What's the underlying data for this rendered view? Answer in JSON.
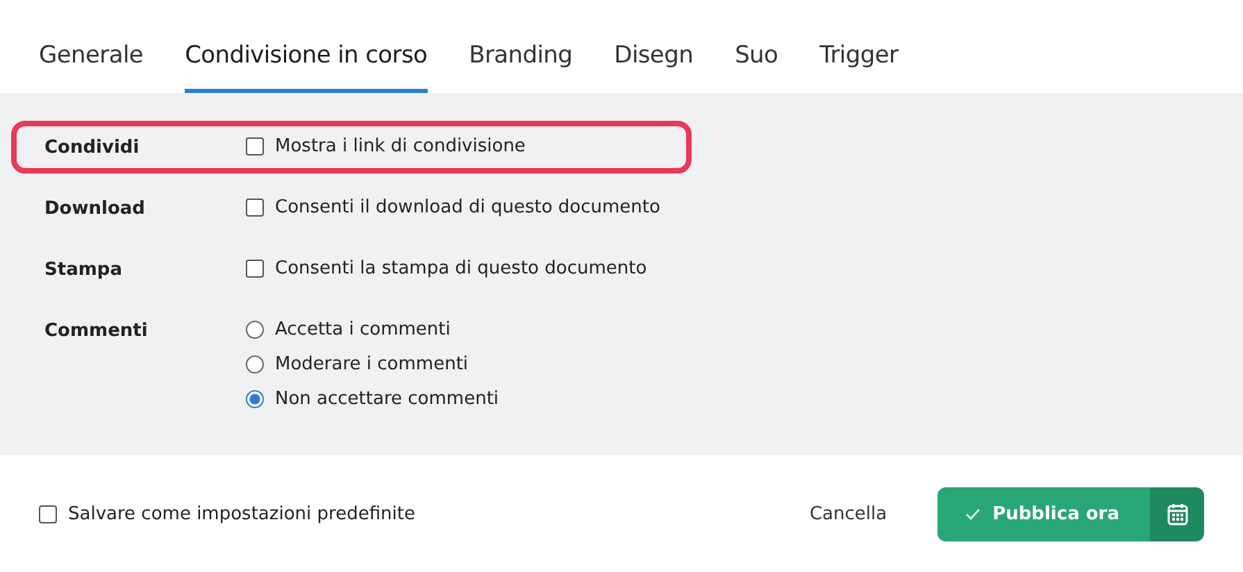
{
  "tabs": [
    {
      "label": "Generale",
      "selected": false
    },
    {
      "label": "Condivisione in corso",
      "selected": true
    },
    {
      "label": "Branding",
      "selected": false
    },
    {
      "label": "Disegn",
      "selected": false
    },
    {
      "label": "Suo",
      "selected": false
    },
    {
      "label": "Trigger",
      "selected": false
    }
  ],
  "settings": [
    {
      "label": "Condividi",
      "highlighted": true,
      "options": [
        {
          "kind": "checkbox",
          "label": "Mostra i link di condivisione",
          "checked": false
        }
      ]
    },
    {
      "label": "Download",
      "highlighted": false,
      "options": [
        {
          "kind": "checkbox",
          "label": "Consenti il download di questo documento",
          "checked": false
        }
      ]
    },
    {
      "label": "Stampa",
      "highlighted": false,
      "options": [
        {
          "kind": "checkbox",
          "label": "Consenti la stampa di questo documento",
          "checked": false
        }
      ]
    },
    {
      "label": "Commenti",
      "highlighted": false,
      "options": [
        {
          "kind": "radio",
          "label": "Accetta i commenti",
          "selected": false
        },
        {
          "kind": "radio",
          "label": "Moderare i commenti",
          "selected": false
        },
        {
          "kind": "radio",
          "label": "Non accettare commenti",
          "selected": true
        }
      ]
    }
  ],
  "footer": {
    "default_checkbox": {
      "label": "Salvare come impostazioni predefinite",
      "checked": false
    },
    "cancel": "Cancella",
    "publish": "Pubblica ora"
  }
}
